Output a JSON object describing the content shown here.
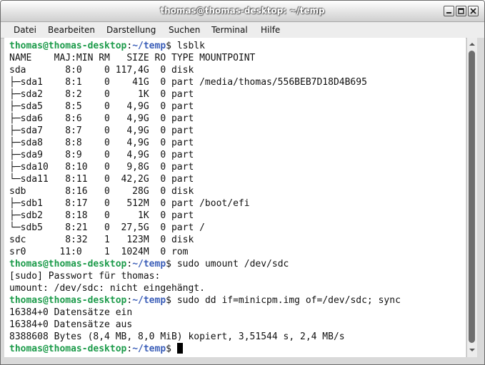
{
  "window": {
    "title": "thomas@thomas-desktop: ~/temp"
  },
  "menu": {
    "items": [
      "Datei",
      "Bearbeiten",
      "Darstellung",
      "Suchen",
      "Terminal",
      "Hilfe"
    ]
  },
  "colors": {
    "prompt_user": "#1c9b4a",
    "prompt_path": "#3b5eb8",
    "text": "#111111",
    "background": "#ffffff"
  },
  "icons": [
    "minimize-icon",
    "maximize-icon",
    "close-icon",
    "scroll-up-icon",
    "scroll-down-icon"
  ],
  "terminal": {
    "prompt_user": "thomas@thomas-desktop",
    "prompt_sep": ":",
    "prompt_path": "~/temp",
    "lines": [
      {
        "type": "prompt",
        "cmd": " lsblk"
      },
      {
        "type": "out",
        "text": "NAME    MAJ:MIN RM   SIZE RO TYPE MOUNTPOINT"
      },
      {
        "type": "out",
        "text": "sda       8:0    0 117,4G  0 disk"
      },
      {
        "type": "out",
        "text": "├─sda1    8:1    0    41G  0 part /media/thomas/556BEB7D18D4B695"
      },
      {
        "type": "out",
        "text": "├─sda2    8:2    0     1K  0 part"
      },
      {
        "type": "out",
        "text": "├─sda5    8:5    0   4,9G  0 part"
      },
      {
        "type": "out",
        "text": "├─sda6    8:6    0   4,9G  0 part"
      },
      {
        "type": "out",
        "text": "├─sda7    8:7    0   4,9G  0 part"
      },
      {
        "type": "out",
        "text": "├─sda8    8:8    0   4,9G  0 part"
      },
      {
        "type": "out",
        "text": "├─sda9    8:9    0   4,9G  0 part"
      },
      {
        "type": "out",
        "text": "├─sda10   8:10   0   9,8G  0 part"
      },
      {
        "type": "out",
        "text": "└─sda11   8:11   0  42,2G  0 part"
      },
      {
        "type": "out",
        "text": "sdb       8:16   0    28G  0 disk"
      },
      {
        "type": "out",
        "text": "├─sdb1    8:17   0   512M  0 part /boot/efi"
      },
      {
        "type": "out",
        "text": "├─sdb2    8:18   0     1K  0 part"
      },
      {
        "type": "out",
        "text": "└─sdb5    8:21   0  27,5G  0 part /"
      },
      {
        "type": "out",
        "text": "sdc       8:32   1   123M  0 disk"
      },
      {
        "type": "out",
        "text": "sr0      11:0    1  1024M  0 rom"
      },
      {
        "type": "prompt",
        "cmd": " sudo umount /dev/sdc"
      },
      {
        "type": "out",
        "text": "[sudo] Passwort für thomas:"
      },
      {
        "type": "out",
        "text": "umount: /dev/sdc: nicht eingehängt."
      },
      {
        "type": "prompt",
        "cmd": " sudo dd if=minicpm.img of=/dev/sdc; sync"
      },
      {
        "type": "out",
        "text": "16384+0 Datensätze ein"
      },
      {
        "type": "out",
        "text": "16384+0 Datensätze aus"
      },
      {
        "type": "out",
        "text": "8388608 Bytes (8,4 MB, 8,0 MiB) kopiert, 3,51544 s, 2,4 MB/s"
      },
      {
        "type": "prompt",
        "cmd": " ",
        "cursor": true
      }
    ]
  }
}
